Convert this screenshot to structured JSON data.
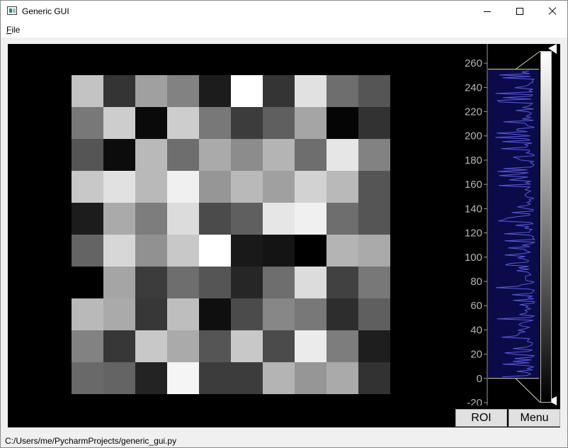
{
  "window": {
    "title": "Generic GUI"
  },
  "menubar": {
    "file": {
      "mnemonic": "F",
      "rest": "ile"
    }
  },
  "image": {
    "rows": 10,
    "cols": 10,
    "gray_values": [
      [
        195,
        52,
        160,
        130,
        28,
        255,
        52,
        225,
        110,
        85
      ],
      [
        120,
        205,
        10,
        205,
        120,
        60,
        95,
        165,
        5,
        50
      ],
      [
        85,
        12,
        185,
        110,
        170,
        140,
        180,
        110,
        230,
        130
      ],
      [
        200,
        225,
        185,
        240,
        150,
        185,
        160,
        210,
        185,
        85
      ],
      [
        28,
        170,
        125,
        220,
        75,
        95,
        230,
        240,
        110,
        85
      ],
      [
        100,
        215,
        145,
        200,
        255,
        25,
        20,
        0,
        180,
        170
      ],
      [
        0,
        165,
        60,
        110,
        85,
        38,
        110,
        220,
        65,
        120
      ],
      [
        185,
        170,
        55,
        190,
        15,
        75,
        135,
        120,
        45,
        95
      ],
      [
        130,
        55,
        200,
        170,
        85,
        200,
        75,
        235,
        125,
        30
      ],
      [
        105,
        100,
        35,
        245,
        60,
        60,
        180,
        150,
        170,
        50
      ]
    ]
  },
  "histogram": {
    "axis_ticks": [
      "260",
      "240",
      "220",
      "200",
      "180",
      "160",
      "140",
      "120",
      "100",
      "80",
      "60",
      "40",
      "20",
      "0",
      "-20"
    ],
    "axis_range": [
      -20,
      270
    ],
    "region": [
      0,
      255
    ],
    "fill_color": "#0b0b4a",
    "curve_color": "#5a5ad8",
    "level_handle_color": "#ffffff"
  },
  "buttons": {
    "roi": "ROI",
    "menu": "Menu"
  },
  "status": {
    "path": "C:/Users/me/PycharmProjects/generic_gui.py"
  }
}
